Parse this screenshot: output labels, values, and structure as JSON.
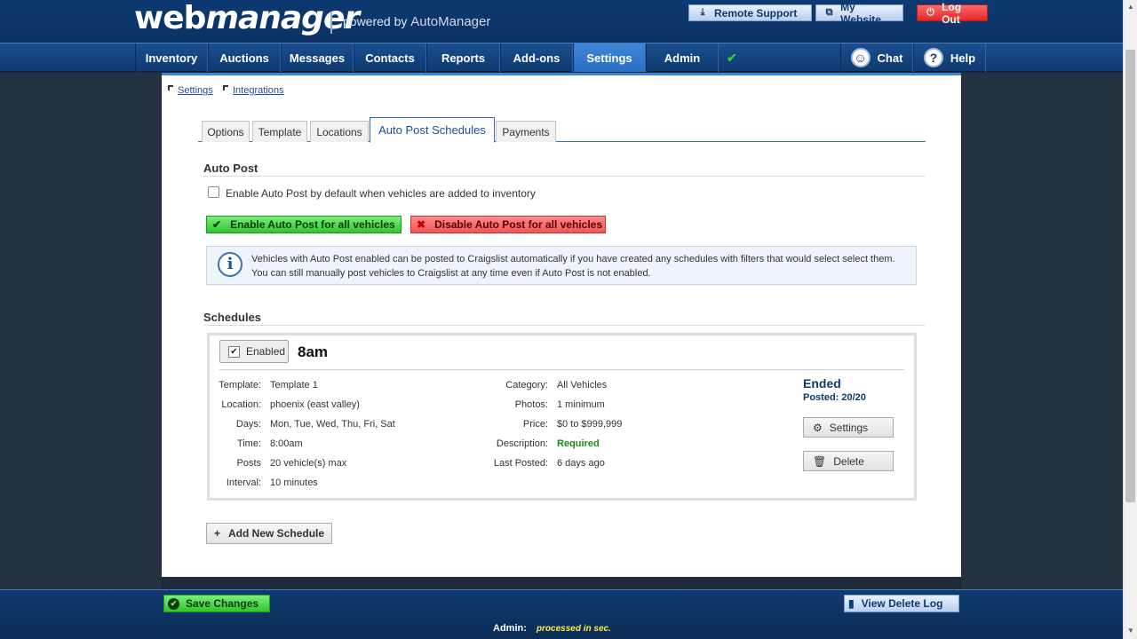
{
  "header": {
    "logo_web": "web",
    "logo_manager": "manager",
    "logo_powered": "powered by",
    "logo_brand": "AutoManager",
    "remote_support": "Remote Support",
    "my_website": "My Website",
    "log_out": "Log Out"
  },
  "nav": {
    "items": [
      "Inventory",
      "Auctions",
      "Messages",
      "Contacts",
      "Reports",
      "Add-ons",
      "Settings",
      "Admin"
    ],
    "active": "Settings",
    "chat": "Chat",
    "help": "Help"
  },
  "breadcrumbs": [
    "Settings",
    "Integrations"
  ],
  "tabs": [
    "Options",
    "Template",
    "Locations",
    "Auto Post Schedules",
    "Payments"
  ],
  "auto_post": {
    "title": "Auto Post",
    "checkbox_label": "Enable Auto Post by default when vehicles are added to inventory",
    "enable_all": "Enable Auto Post for all vehicles",
    "disable_all": "Disable Auto Post for all vehicles",
    "info_line1": "Vehicles with Auto Post enabled can be posted to Craigslist automatically if you have created any schedules with filters that would select select them.",
    "info_line2": "You can still manually post vehicles to Craigslist at any time even if Auto Post is not enabled."
  },
  "schedules": {
    "title": "Schedules",
    "add_new": "Add New Schedule",
    "item": {
      "enabled_label": "Enabled",
      "name": "8am",
      "left": [
        {
          "k": "Template:",
          "v": "Template 1"
        },
        {
          "k": "Location:",
          "v": "phoenix (east valley)"
        },
        {
          "k": "Days:",
          "v": "Mon, Tue, Wed, Thu, Fri, Sat"
        },
        {
          "k": "Time:",
          "v": "8:00am"
        },
        {
          "k": "Posts",
          "v": "20 vehicle(s) max"
        },
        {
          "k": "Interval:",
          "v": "10 minutes"
        }
      ],
      "right": [
        {
          "k": "Category:",
          "v": "All Vehicles"
        },
        {
          "k": "Photos:",
          "v": "1 minimum"
        },
        {
          "k": "Price:",
          "v": "$0 to $999,999"
        },
        {
          "k": "Description:",
          "v": "Required"
        },
        {
          "k": "Last Posted:",
          "v": "6 days ago"
        }
      ],
      "status": "Ended",
      "posted": "Posted: 20/20",
      "settings_btn": "Settings",
      "delete_btn": "Delete"
    }
  },
  "footer": {
    "save": "Save Changes",
    "view_log": "View Delete Log",
    "admin_label": "Admin:",
    "processed": "processed in sec."
  },
  "colors": {
    "header_blue": "#0d3a72",
    "active_tab": "#2a6ec0",
    "green": "#2fc52f",
    "red": "#f05555"
  }
}
